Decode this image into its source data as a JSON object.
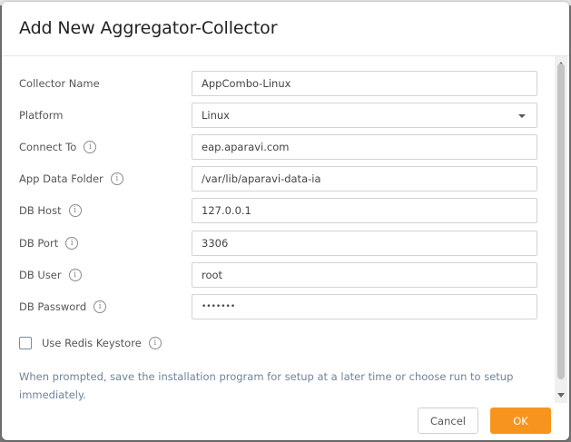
{
  "dialog": {
    "title": "Add New Aggregator-Collector"
  },
  "form": {
    "collector_name": {
      "label": "Collector Name",
      "value": "AppCombo-Linux"
    },
    "platform": {
      "label": "Platform",
      "value": "Linux"
    },
    "connect_to": {
      "label": "Connect To",
      "value": "eap.aparavi.com"
    },
    "app_data_folder": {
      "label": "App Data Folder",
      "value": "/var/lib/aparavi-data-ia"
    },
    "db_host": {
      "label": "DB Host",
      "value": "127.0.0.1"
    },
    "db_port": {
      "label": "DB Port",
      "value": "3306"
    },
    "db_user": {
      "label": "DB User",
      "value": "root"
    },
    "db_password": {
      "label": "DB Password",
      "value": "•••••••"
    },
    "use_redis": {
      "label": "Use Redis Keystore",
      "checked": false
    }
  },
  "info_glyph": "i",
  "note": "When prompted, save the installation program for setup at a later time or choose run to setup immediately.",
  "buttons": {
    "cancel": "Cancel",
    "ok": "OK"
  },
  "colors": {
    "ok_button": "#f7941d",
    "note_text": "#6f8399"
  }
}
